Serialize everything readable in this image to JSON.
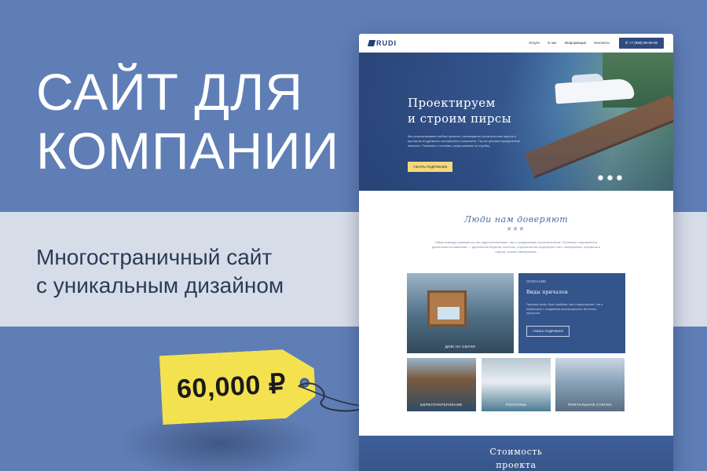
{
  "promo": {
    "headline_line1": "САЙТ ДЛЯ",
    "headline_line2": "КОМПАНИИ",
    "subtitle_line1": "Многостраничный сайт",
    "subtitle_line2": "с уникальным дизайном",
    "price": "60,000 ₽"
  },
  "mockup": {
    "logo_text": "RUDI",
    "nav_links": [
      "Услуги",
      "О нас",
      "Информация",
      "Контакты"
    ],
    "phone": "+7 (999) 99-00-00",
    "hero": {
      "title_line1": "Проектируем",
      "title_line2": "и строим пирсы",
      "text": "Мы реализовываем любые проекты, касающиеся строительства пирсов и причалов из древесно-полимерного композита. Так же решаем юридические вопросы. Поможем с плотами, разрешением на стройку.",
      "cta": "УЗНАТЬ ПОДРОБНЕЕ"
    },
    "trust": {
      "title": "Люди нам доверяют",
      "ornament": "✕✕✕",
      "text": "Наша команда занимается как гидротехническим, так и гражданским строительством. Основные направления деятельности компании — укрепление берегов, понтоны, строительство подпорных стен, набережных, причалов и пирсов, ремонт материалов."
    },
    "cards": {
      "big_label": "ДОМ НА СВАЯХ",
      "desc_small": "ОПИСАНИЕ",
      "desc_title": "Виды причалов",
      "desc_text": "Причалы могут быть свайные, как стационарные, так и мобильные с созданием высокопрочных бетонных причалов.",
      "desc_button": "УЗНАТЬ ПОДРОБНЕЕ",
      "small_labels": [
        "БЕРЕГОУКРЕПЛЕНИЕ",
        "ПОНТОНЫ",
        "ПРИЧАЛЬНАЯ СТЕНКА"
      ]
    },
    "cost": {
      "title_line1": "Стоимость",
      "title_line2": "проекта"
    }
  }
}
